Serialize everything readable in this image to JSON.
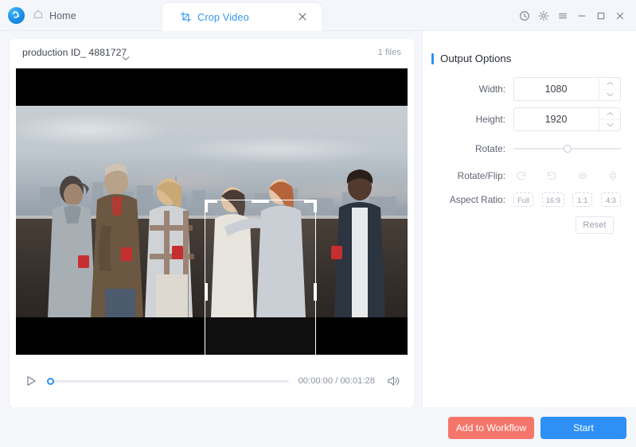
{
  "window": {
    "home_label": "Home",
    "logo_icon": "app-logo-icon",
    "home_icon": "house-icon",
    "controls": [
      {
        "name": "history-icon",
        "label": "History"
      },
      {
        "name": "settings-gear-icon",
        "label": "Settings"
      },
      {
        "name": "menu-hamburger-icon",
        "label": "Menu"
      },
      {
        "name": "minimize-icon",
        "label": "Minimize"
      },
      {
        "name": "maximize-icon",
        "label": "Maximize"
      },
      {
        "name": "close-icon",
        "label": "Close"
      }
    ]
  },
  "tab": {
    "label": "Crop Video",
    "icon": "crop-icon",
    "close_icon": "close-icon",
    "active": true
  },
  "preview": {
    "file_name": "production ID_ 4881727",
    "file_count": "1 files",
    "chevron_icon": "chevron-down-icon"
  },
  "player": {
    "play_icon": "play-icon",
    "volume_icon": "volume-icon",
    "time_display": "00:00:00 / 00:01:28",
    "current_time": "00:00:00",
    "duration": "00:01:28",
    "progress_percent": 0
  },
  "crop": {
    "handles": 8,
    "border_color": "#ffffff"
  },
  "panel": {
    "title": "Output Options",
    "accent_color": "#2e90f5",
    "width": {
      "label": "Width:",
      "value": "1080"
    },
    "height": {
      "label": "Height:",
      "value": "1920"
    },
    "rotate": {
      "label": "Rotate:",
      "value_percent": 50
    },
    "rotate_flip": {
      "label": "Rotate/Flip:",
      "buttons": [
        {
          "name": "rotate-clockwise-icon",
          "label": "Rotate Right"
        },
        {
          "name": "rotate-counterclockwise-icon",
          "label": "Rotate Left"
        },
        {
          "name": "flip-horizontal-icon",
          "label": "Flip Horizontal"
        },
        {
          "name": "flip-vertical-icon",
          "label": "Flip Vertical"
        }
      ]
    },
    "aspect_ratio": {
      "label": "Aspect Ratio:",
      "options": [
        "Full",
        "16:9",
        "1:1",
        "4:3"
      ],
      "selected": "Full"
    },
    "reset_label": "Reset"
  },
  "footer": {
    "add_to_workflow_label": "Add to Workflow",
    "add_to_workflow_color": "#f4766b",
    "start_label": "Start",
    "start_color": "#2e90f5"
  }
}
